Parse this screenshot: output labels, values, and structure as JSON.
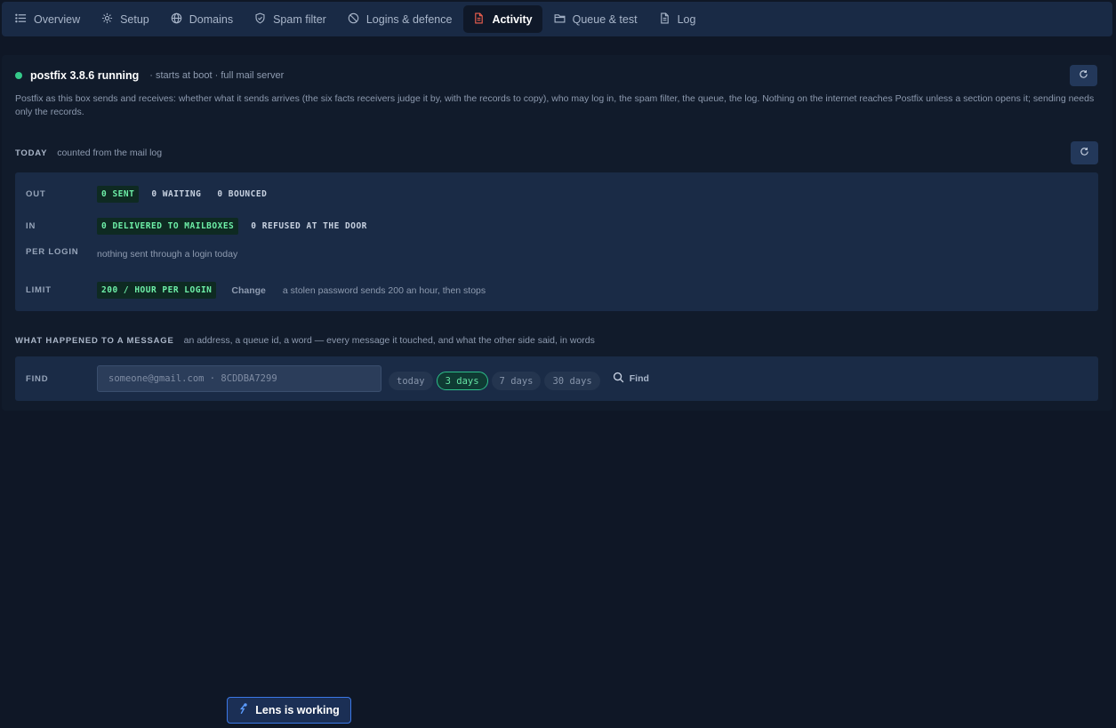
{
  "tabs": [
    {
      "label": "Overview",
      "icon": "list-icon"
    },
    {
      "label": "Setup",
      "icon": "gear-icon"
    },
    {
      "label": "Domains",
      "icon": "globe-icon"
    },
    {
      "label": "Spam filter",
      "icon": "shield-icon"
    },
    {
      "label": "Logins & defence",
      "icon": "ban-icon"
    },
    {
      "label": "Activity",
      "icon": "document-icon",
      "active": true
    },
    {
      "label": "Queue & test",
      "icon": "folder-icon"
    },
    {
      "label": "Log",
      "icon": "file-icon"
    }
  ],
  "status": {
    "title": "postfix 3.8.6 running",
    "subtitle": "· starts at boot · full mail server",
    "state_color": "#35c98a",
    "description": "Postfix as this box sends and receives: whether what it sends arrives (the six facts receivers judge it by, with the records to copy), who may log in, the spam filter, the queue, the log. Nothing on the internet reaches Postfix unless a section opens it; sending needs only the records."
  },
  "today": {
    "label": "TODAY",
    "hint": "counted from the mail log",
    "out_label": "OUT",
    "out_sent": "0 SENT",
    "out_waiting": "0 WAITING",
    "out_bounced": "0 BOUNCED",
    "in_label": "IN",
    "in_delivered": "0 DELIVERED TO MAILBOXES",
    "in_refused": "0 REFUSED AT THE DOOR",
    "per_login_label": "PER LOGIN",
    "per_login_note": "nothing sent through a login today",
    "limit_label": "LIMIT",
    "limit_value": "200 / HOUR PER LOGIN",
    "limit_change": "Change",
    "limit_note": "a stolen password sends 200 an hour, then stops"
  },
  "search": {
    "label": "WHAT HAPPENED TO A MESSAGE",
    "hint": "an address, a queue id, a word — every message it touched, and what the other side said, in words",
    "find_label": "FIND",
    "placeholder": "someone@gmail.com · 8CDDBA7299",
    "ranges": [
      "today",
      "3 days",
      "7 days",
      "30 days"
    ],
    "selected_range": "3 days",
    "find_button": "Find"
  },
  "toast": {
    "text": "Lens is working"
  }
}
